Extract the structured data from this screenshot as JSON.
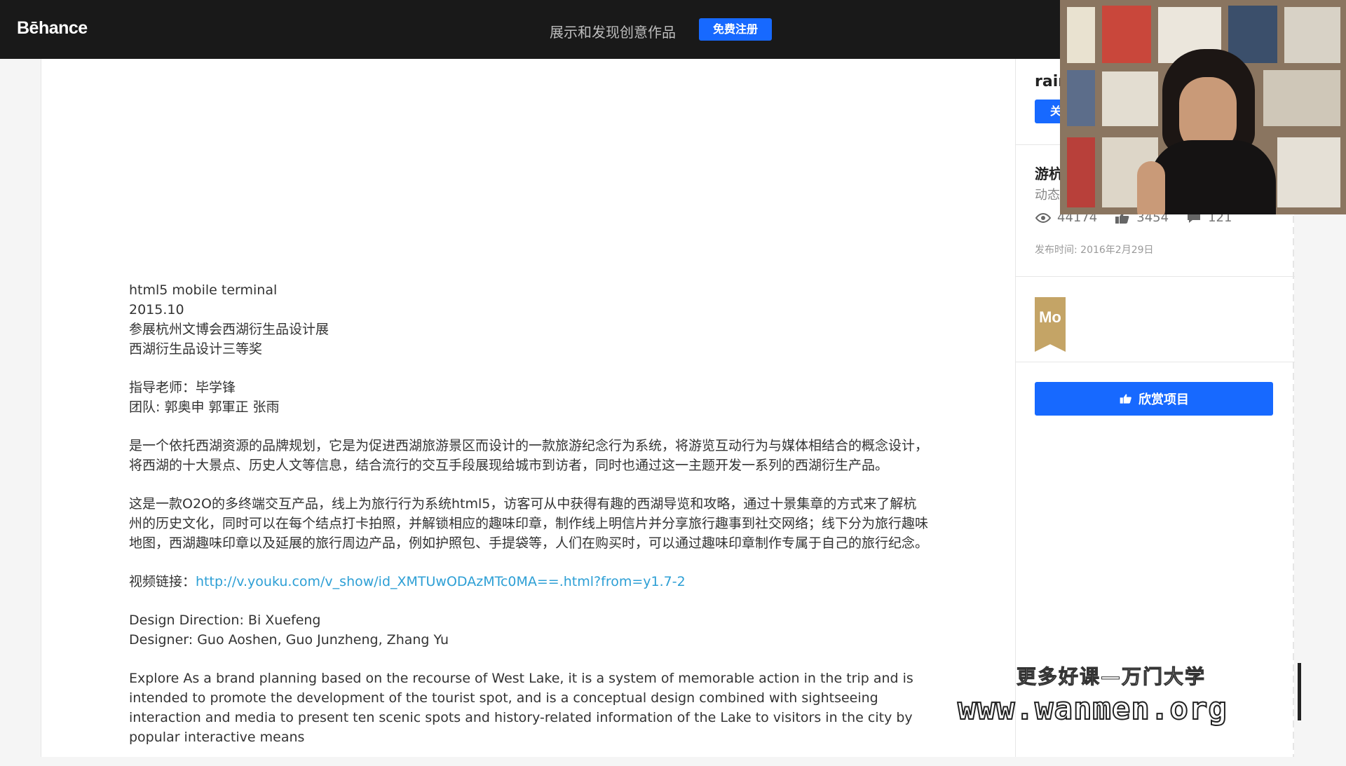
{
  "header": {
    "logo": "Bēhance",
    "tagline": "展示和发现创意作品",
    "signup_label": "免费注册"
  },
  "content": {
    "lines1": [
      "html5 mobile terminal",
      "2015.10",
      "参展杭州文博会西湖衍生品设计展",
      "西湖衍生品设计三等奖"
    ],
    "lines2": [
      "指导老师：毕学锋",
      "团队: 郭奥申  郭軍正  张雨"
    ],
    "para1": "是一个依托西湖资源的品牌规划，它是为促进西湖旅游景区而设计的一款旅游纪念行为系统，将游览互动行为与媒体相结合的概念设计，将西湖的十大景点、历史人文等信息，结合流行的交互手段展现给城市到访者，同时也通过这一主题开发一系列的西湖衍生产品。",
    "para2": "这是一款O2O的多终端交互产品，线上为旅行行为系统html5，访客可从中获得有趣的西湖导览和攻略，通过十景集章的方式来了解杭州的历史文化，同时可以在每个结点打卡拍照，并解锁相应的趣味印章，制作线上明信片并分享旅行趣事到社交网络；线下分为旅行趣味地图，西湖趣味印章以及延展的旅行周边产品，例如护照包、手提袋等，人们在购买时，可以通过趣味印章制作专属于自己的旅行纪念。",
    "video_label": "视频链接：",
    "video_url": "http://v.youku.com/v_show/id_XMTUwODAzMTc0MA==.html?from=y1.7-2",
    "credits": [
      "Design Direction: Bi Xuefeng",
      "Designer: Guo Aoshen, Guo Junzheng, Zhang Yu"
    ],
    "english": "Explore As a brand planning based on the recourse of West Lake, it is a system of memorable action in the trip and is intended to promote the development of the tourist spot, and is a conceptual design combined with sightseeing interaction and media to present ten scenic spots and history-related information of the Lake to visitors in the city by popular interactive means"
  },
  "sidebar": {
    "author": "rain",
    "follow_label": "关",
    "project_title": "游杭",
    "project_category": "动态",
    "views": "44174",
    "likes": "3454",
    "comments": "121",
    "publish_date": "发布时间: 2016年2月29日",
    "ribbon_text": "Mo",
    "appreciate_label": "欣赏项目"
  },
  "watermark": {
    "line1": "更多好课—万门大学",
    "line2": "www.wanmen.org"
  },
  "colors": {
    "accent": "#1769ff",
    "header_bg": "#191919",
    "link": "#2d9fd5",
    "ribbon": "#c4a466"
  }
}
